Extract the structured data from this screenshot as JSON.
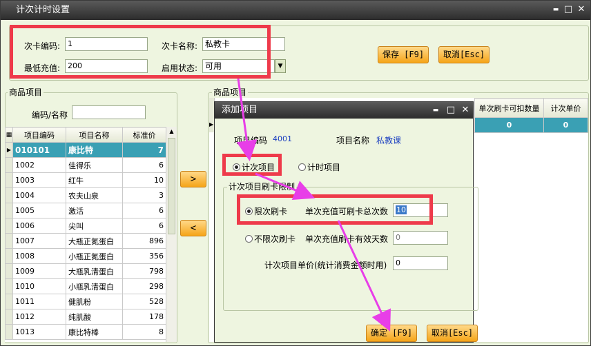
{
  "window": {
    "title": "计次计时设置",
    "minimize": "▬",
    "maximize": "□",
    "close": "✕"
  },
  "card": {
    "code_label": "次卡编码:",
    "code_value": "1",
    "name_label": "次卡名称:",
    "name_value": "私教卡",
    "min_charge_label": "最低充值:",
    "min_charge_value": "200",
    "status_label": "启用状态:",
    "status_value": "可用"
  },
  "toolbar": {
    "save_label": "保存 [F9]",
    "cancel_label": "取消[Esc]"
  },
  "left_panel": {
    "title": "商品项目",
    "search_label": "编码/名称",
    "search_value": "",
    "columns": [
      "项目编码",
      "项目名称",
      "标准价"
    ],
    "rows": [
      {
        "code": "010101",
        "name": "康比特",
        "price": "7"
      },
      {
        "code": "1002",
        "name": "佳得乐",
        "price": "6"
      },
      {
        "code": "1003",
        "name": "红牛",
        "price": "10"
      },
      {
        "code": "1004",
        "name": "农夫山泉",
        "price": "3"
      },
      {
        "code": "1005",
        "name": "激活",
        "price": "6"
      },
      {
        "code": "1006",
        "name": "尖叫",
        "price": "6"
      },
      {
        "code": "1007",
        "name": "大瓶正氮蛋白",
        "price": "896"
      },
      {
        "code": "1008",
        "name": "小瓶正氮蛋白",
        "price": "356"
      },
      {
        "code": "1009",
        "name": "大瓶乳清蛋白",
        "price": "798"
      },
      {
        "code": "1010",
        "name": "小瓶乳清蛋白",
        "price": "298"
      },
      {
        "code": "1011",
        "name": "健肌粉",
        "price": "528"
      },
      {
        "code": "1012",
        "name": "纯肌酸",
        "price": "178"
      },
      {
        "code": "1013",
        "name": "康比特棒",
        "price": "8"
      }
    ]
  },
  "transfer": {
    "add_label": ">",
    "remove_label": "<"
  },
  "right_panel": {
    "title": "商品项目",
    "columns": [
      "单次刷卡可扣数量",
      "计次单价"
    ],
    "row": [
      "0",
      "0"
    ]
  },
  "dialog": {
    "title": "添加项目",
    "item_code_label": "项目编码",
    "item_code_value": "4001",
    "item_name_label": "项目名称",
    "item_name_value": "私教课",
    "type_count_label": "计次项目",
    "type_time_label": "计时项目",
    "limit_group_title": "计次项目刷卡限制",
    "limited_label": "限次刷卡",
    "limited_field_label": "单次充值可刷卡总次数",
    "limited_value": "10",
    "unlimited_label": "不限次刷卡",
    "unlimited_field_label": "单次充值刷卡有效天数",
    "unlimited_value": "0",
    "unit_price_label": "计次项目单价(统计消费金额时用)",
    "unit_price_value": "0",
    "confirm_label": "确定 [F9]",
    "cancel_label": "取消[Esc]"
  },
  "colors": {
    "highlight": "#ee3a4a",
    "arrow": "#e83ee8",
    "selected_row": "#3aa0b4",
    "button": "#f5a418"
  }
}
